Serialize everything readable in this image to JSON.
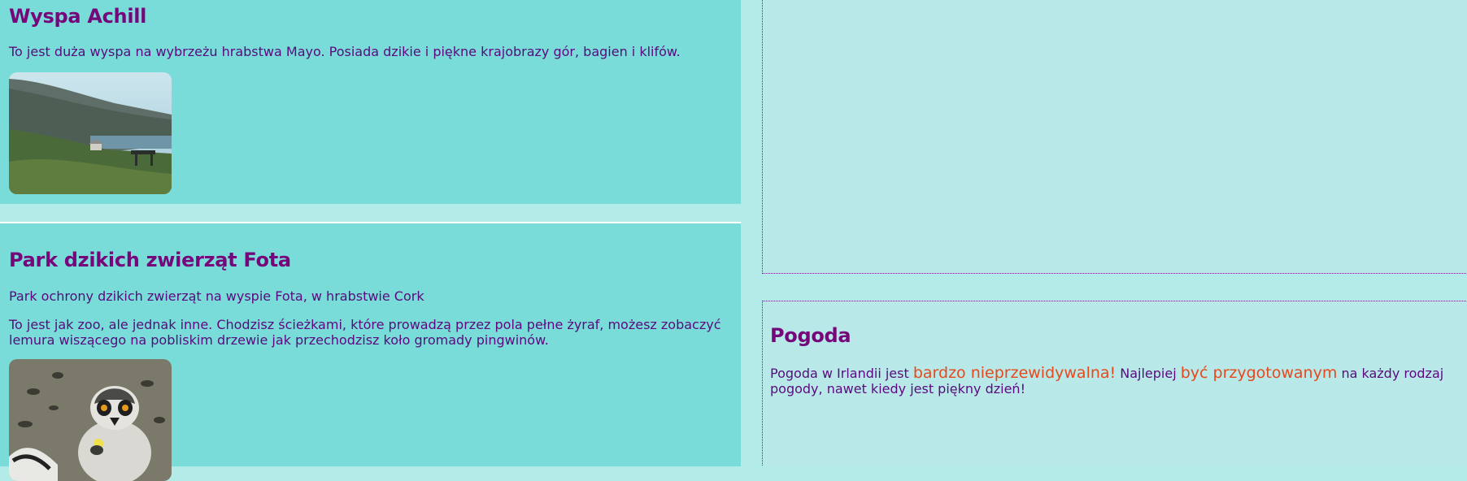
{
  "articles": [
    {
      "title": "Wyspa Achill",
      "paragraphs": [
        "To jest duża wyspa na wybrzeżu hrabstwa Mayo. Posiada dzikie i piękne krajobrazy gór, bagien i klifów."
      ],
      "image": "achill-island-landscape"
    },
    {
      "title": "Park dzikich zwierząt Fota",
      "paragraphs": [
        "Park ochrony dzikich zwierząt na wyspie Fota, w hrabstwie Cork",
        "To jest jak zoo, ale jednak inne. Chodzisz ścieżkami, które prowadzą przez pola pełne żyraf, możesz zobaczyć lemura wiszącego na pobliskim drzewie jak przechodzisz koło gromady pingwinów."
      ],
      "image": "ring-tailed-lemur"
    }
  ],
  "weather": {
    "title": "Pogoda",
    "text_1": "Pogoda w Irlandii jest ",
    "highlight_1": "bardzo nieprzewidywalna!",
    "text_2": " Najlepiej ",
    "highlight_2": "być przygotowanym",
    "text_3": " na każdy rodzaj pogody, nawet kiedy jest piękny dzień!"
  },
  "colors": {
    "page_background": "#b3ebe8",
    "article_background": "#79dcd8",
    "aside_background": "#b8e9e8",
    "heading": "#76077a",
    "body_text": "#5a0a7e",
    "highlight": "#e8481c"
  }
}
